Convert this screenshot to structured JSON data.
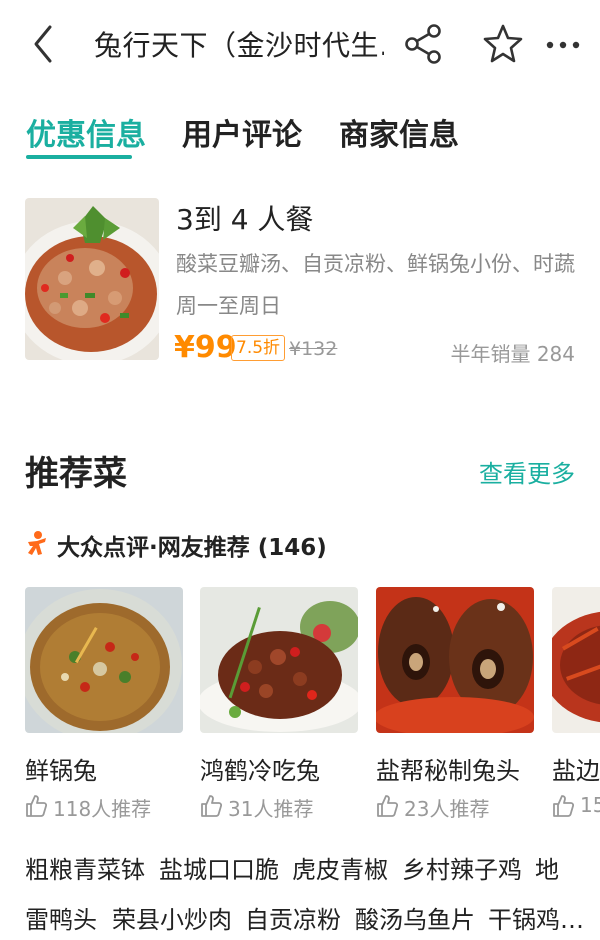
{
  "header": {
    "title": "兔行天下（金沙时代生…",
    "icons": [
      "back-icon",
      "share-icon",
      "star-icon",
      "more-icon"
    ]
  },
  "tabs": [
    {
      "label": "优惠信息",
      "active": true
    },
    {
      "label": "用户评论",
      "active": false
    },
    {
      "label": "商家信息",
      "active": false
    }
  ],
  "deal": {
    "title": "3到 4 人餐",
    "description": "酸菜豆瓣汤、自贡凉粉、鲜锅兔小份、时蔬",
    "days": "周一至周日",
    "price": "¥99",
    "discount": "7.5折",
    "original_price": "¥132",
    "sales": "半年销量 284"
  },
  "recommended": {
    "title": "推荐菜",
    "more_label": "查看更多",
    "source_label": "大众点评·网友推荐 (146)",
    "dishes": [
      {
        "name": "鲜锅兔",
        "likes": "118人推荐"
      },
      {
        "name": "鸿鹤冷吃兔",
        "likes": "31人推荐"
      },
      {
        "name": "盐帮秘制兔头",
        "likes": "23人推荐"
      },
      {
        "name": "盐边",
        "likes": "15"
      }
    ],
    "tag_rows": [
      [
        "粗粮青菜钵",
        "盐城口口脆",
        "虎皮青椒",
        "乡村辣子鸡",
        "地"
      ],
      [
        "雷鸭头",
        "荣县小炒肉",
        "自贡凉粉",
        "酸汤乌鱼片",
        "干锅鸡…"
      ]
    ]
  },
  "colors": {
    "accent": "#1aafa0",
    "price": "#ff8a00",
    "text": "#222222",
    "muted": "#999999",
    "logo": "#ff6a1a"
  }
}
